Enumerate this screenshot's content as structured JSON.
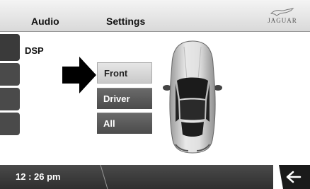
{
  "header": {
    "tabs": [
      "Audio",
      "Settings"
    ],
    "brand": "JAGUAR"
  },
  "section": {
    "label": "DSP"
  },
  "options": [
    {
      "label": "Front",
      "selected": true
    },
    {
      "label": "Driver",
      "selected": false
    },
    {
      "label": "All",
      "selected": false
    }
  ],
  "footer": {
    "time": "12 : 26 pm"
  },
  "icons": {
    "pointer": "arrow-right-icon",
    "car": "car-top-view-icon",
    "back": "back-arrow-icon",
    "brand": "jaguar-leaper-logo"
  },
  "colors": {
    "header": "#e6e6e6",
    "button_dark": "#555555",
    "button_selected": "#d6d6d6",
    "footer": "#3a3a3a"
  }
}
